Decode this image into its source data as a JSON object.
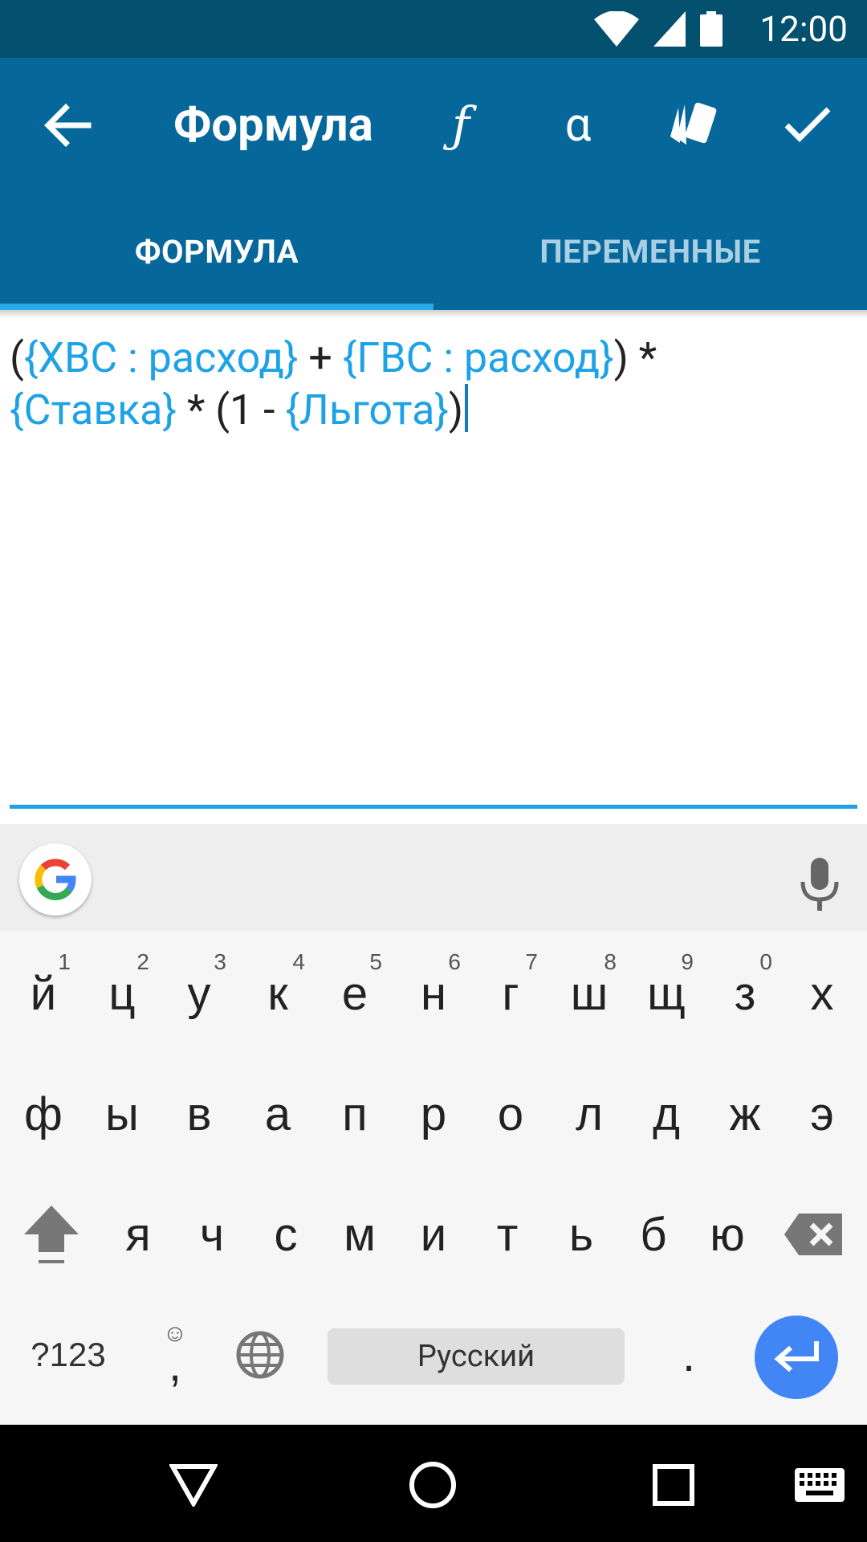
{
  "status_bar": {
    "time": "12:00",
    "icons": [
      "wifi-icon",
      "signal-icon",
      "battery-icon"
    ]
  },
  "app_bar": {
    "title": "Формула",
    "actions": [
      {
        "name": "function-icon",
        "glyph": "ƒ"
      },
      {
        "name": "alpha-icon",
        "glyph": "α"
      },
      {
        "name": "tag-icon"
      },
      {
        "name": "check-icon"
      }
    ]
  },
  "tabs": [
    {
      "label": "ФОРМУЛА",
      "active": true
    },
    {
      "label": "ПЕРЕМЕННЫЕ",
      "active": false
    }
  ],
  "formula": {
    "tokens": [
      {
        "t": "(",
        "v": false
      },
      {
        "t": "{ХВС : расход}",
        "v": true
      },
      {
        "t": " + ",
        "v": false
      },
      {
        "t": "{ГВС : расход}",
        "v": true
      },
      {
        "t": ") *",
        "v": false
      },
      {
        "t": "{Ставка}",
        "v": true
      },
      {
        "t": " * (1 - ",
        "v": false
      },
      {
        "t": "{Льгота}",
        "v": true
      },
      {
        "t": ")",
        "v": false
      }
    ]
  },
  "keyboard": {
    "row1": [
      {
        "k": "й",
        "h": "1"
      },
      {
        "k": "ц",
        "h": "2"
      },
      {
        "k": "у",
        "h": "3"
      },
      {
        "k": "к",
        "h": "4"
      },
      {
        "k": "е",
        "h": "5"
      },
      {
        "k": "н",
        "h": "6"
      },
      {
        "k": "г",
        "h": "7"
      },
      {
        "k": "ш",
        "h": "8"
      },
      {
        "k": "щ",
        "h": "9"
      },
      {
        "k": "з",
        "h": "0"
      },
      {
        "k": "х",
        "h": ""
      }
    ],
    "row2": [
      "ф",
      "ы",
      "в",
      "а",
      "п",
      "р",
      "о",
      "л",
      "д",
      "ж",
      "э"
    ],
    "row3": [
      "я",
      "ч",
      "с",
      "м",
      "и",
      "т",
      "ь",
      "б",
      "ю"
    ],
    "symbols_label": "?123",
    "comma_label": ",",
    "period_label": ".",
    "space_label": "Русский"
  },
  "colors": {
    "status": "#04506f",
    "primary": "#06679a",
    "accent": "#1ea2e6",
    "enter": "#4285f4"
  }
}
